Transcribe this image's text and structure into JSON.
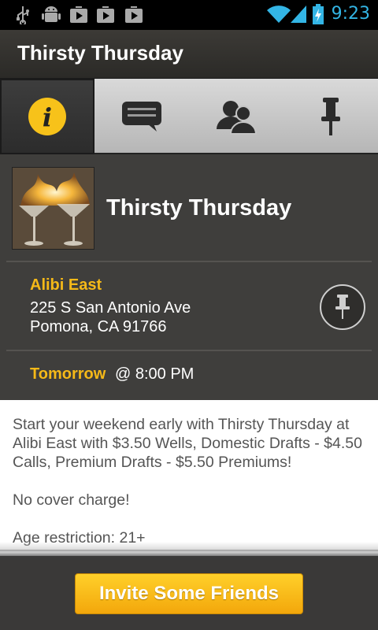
{
  "status_bar": {
    "time": "9:23",
    "left_icons": [
      "usb-icon",
      "android-debug-icon",
      "play-store-icon",
      "play-store-icon",
      "play-store-icon"
    ],
    "right_icons": [
      "wifi-icon",
      "signal-icon",
      "battery-charging-icon"
    ],
    "time_color": "#33b5e5"
  },
  "action_bar": {
    "title": "Thirsty Thursday"
  },
  "tabs": [
    {
      "icon": "info-icon",
      "active": true
    },
    {
      "icon": "chat-icon",
      "active": false
    },
    {
      "icon": "people-icon",
      "active": false
    },
    {
      "icon": "pushpin-icon",
      "active": false
    }
  ],
  "event": {
    "title": "Thirsty Thursday",
    "image": "flaming-cocktails-photo"
  },
  "venue": {
    "name": "Alibi East",
    "address_line1": "225 S San Antonio Ave",
    "address_line2": "Pomona, CA 91766"
  },
  "schedule": {
    "day": "Tomorrow",
    "time": "@ 8:00 PM"
  },
  "description": {
    "paragraph1": "Start your weekend early with Thirsty Thursday at Alibi East with $3.50 Wells, Domestic Drafts - $4.50 Calls, Premium Drafts - $5.50 Premiums!",
    "paragraph2": "No cover charge!",
    "paragraph3": "Age restriction: 21+"
  },
  "footer": {
    "invite_label": "Invite Some Friends"
  },
  "colors": {
    "accent": "#f5b918",
    "panel": "#3f3e3c",
    "button": "#f8bd18"
  }
}
